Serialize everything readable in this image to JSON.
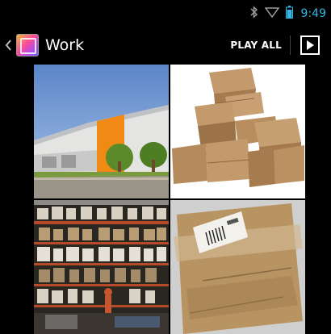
{
  "status_bar": {
    "time": "9:49",
    "icons": [
      "bluetooth-icon",
      "wifi-icon",
      "battery-icon"
    ],
    "accent_color": "#33b5e5"
  },
  "action_bar": {
    "title": "Work",
    "play_all_label": "PLAY ALL",
    "icons": [
      "back-chevron-icon",
      "album-icon",
      "play-icon"
    ]
  },
  "album": {
    "items": [
      {
        "subject": "warehouse building"
      },
      {
        "subject": "stacked cardboard boxes"
      },
      {
        "subject": "warehouse shelves"
      },
      {
        "subject": "package with shipping label"
      }
    ]
  }
}
